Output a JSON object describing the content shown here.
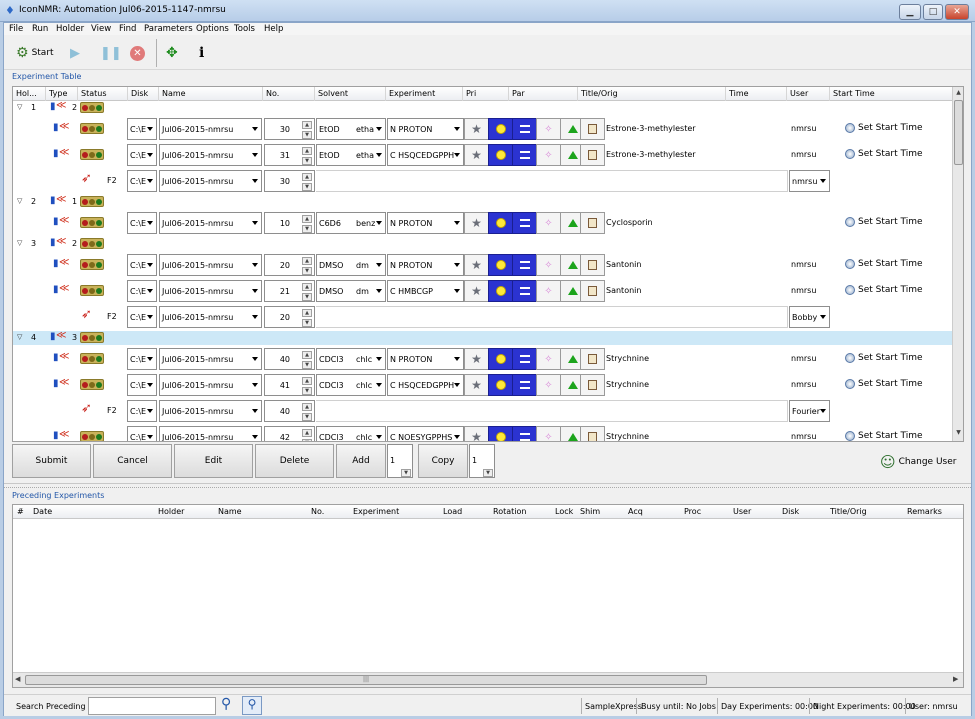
{
  "window": {
    "title": "IconNMR: Automation Jul06-2015-1147-nmrsu",
    "minimize": "▁",
    "maximize": "□",
    "close": "✕"
  },
  "menu": [
    "File",
    "Run",
    "Holder",
    "View",
    "Find",
    "Parameters",
    "Options",
    "Tools",
    "Help"
  ],
  "toolbar": {
    "start_label": "Start"
  },
  "experiment_table": {
    "title": "Experiment Table",
    "columns": [
      "Hol...",
      "Type",
      "Status",
      "Disk",
      "Name",
      "No.",
      "Solvent",
      "Experiment",
      "Pri",
      "Par",
      "Title/Orig",
      "Time",
      "User",
      "Start Time"
    ],
    "groups": [
      {
        "holder": "1",
        "count": "2",
        "rows": [
          {
            "kind": "exp",
            "disk": "C:\\E",
            "name": "Jul06-2015-nmrsu",
            "no": "30",
            "solvent": "EtOD",
            "solv2": "etha",
            "experiment": "N PROTON",
            "title": "Estrone-3-methylester",
            "user": "nmrsu",
            "start": "Set Start Time"
          },
          {
            "kind": "exp",
            "disk": "C:\\E",
            "name": "Jul06-2015-nmrsu",
            "no": "31",
            "solvent": "EtOD",
            "solv2": "etha",
            "experiment": "C HSQCEDGPPH",
            "title": "Estrone-3-methylester",
            "user": "nmrsu",
            "start": "Set Start Time"
          },
          {
            "kind": "f2",
            "label": "F2",
            "disk": "C:\\E",
            "name": "Jul06-2015-nmrsu",
            "no": "30",
            "user": "nmrsu"
          }
        ]
      },
      {
        "holder": "2",
        "count": "1",
        "rows": [
          {
            "kind": "exp",
            "disk": "C:\\E",
            "name": "Jul06-2015-nmrsu",
            "no": "10",
            "solvent": "C6D6",
            "solv2": "benz",
            "experiment": "N PROTON",
            "title": "Cyclosporin",
            "user": "",
            "start": "Set Start Time"
          }
        ]
      },
      {
        "holder": "3",
        "count": "2",
        "rows": [
          {
            "kind": "exp",
            "disk": "C:\\E",
            "name": "Jul06-2015-nmrsu",
            "no": "20",
            "solvent": "DMSO",
            "solv2": "dm",
            "experiment": "N PROTON",
            "title": "Santonin",
            "user": "nmrsu",
            "start": "Set Start Time"
          },
          {
            "kind": "exp",
            "disk": "C:\\E",
            "name": "Jul06-2015-nmrsu",
            "no": "21",
            "solvent": "DMSO",
            "solv2": "dm",
            "experiment": "C HMBCGP",
            "title": "Santonin",
            "user": "nmrsu",
            "start": "Set Start Time"
          },
          {
            "kind": "f2",
            "label": "F2",
            "disk": "C:\\E",
            "name": "Jul06-2015-nmrsu",
            "no": "20",
            "user": "Bobby"
          }
        ]
      },
      {
        "holder": "4",
        "count": "3",
        "rows": [
          {
            "kind": "exp",
            "disk": "C:\\E",
            "name": "Jul06-2015-nmrsu",
            "no": "40",
            "solvent": "CDCl3",
            "solv2": "chlc",
            "experiment": "N PROTON",
            "title": "Strychnine",
            "user": "nmrsu",
            "start": "Set Start Time"
          },
          {
            "kind": "exp",
            "disk": "C:\\E",
            "name": "Jul06-2015-nmrsu",
            "no": "41",
            "solvent": "CDCl3",
            "solv2": "chlc",
            "experiment": "C HSQCEDGPPH",
            "title": "Strychnine",
            "user": "nmrsu",
            "start": "Set Start Time"
          },
          {
            "kind": "f2",
            "label": "F2",
            "disk": "C:\\E",
            "name": "Jul06-2015-nmrsu",
            "no": "40",
            "user": "Fourier"
          },
          {
            "kind": "exp",
            "disk": "C:\\E",
            "name": "Jul06-2015-nmrsu",
            "no": "42",
            "solvent": "CDCl3",
            "solv2": "chlc",
            "experiment": "C NOESYGPPHS",
            "title": "Strychnine",
            "user": "nmrsu",
            "start": "Set Start Time"
          }
        ]
      }
    ]
  },
  "buttons": {
    "submit": "Submit",
    "cancel": "Cancel",
    "edit": "Edit",
    "delete": "Delete",
    "add": "Add",
    "add_count": "1",
    "copy": "Copy",
    "copy_count": "1",
    "change_user": "Change User"
  },
  "preceding": {
    "title": "Preceding Experiments",
    "columns": [
      "#",
      "Date",
      "Holder",
      "Name",
      "No.",
      "Experiment",
      "Load",
      "Rotation",
      "Lock",
      "Shim",
      "Acq",
      "Proc",
      "User",
      "Disk",
      "Title/Orig",
      "Remarks"
    ],
    "scroll_grip": "|||"
  },
  "status": {
    "search_label": "Search Preceding",
    "search_value": "",
    "sample_changer": "SampleXpress",
    "busy": "Busy until:  No Jobs!",
    "day": "Day Experiments:  00:00",
    "night": "Night Experiments:  00:00",
    "user": "User:  nmrsu"
  },
  "icons": {
    "start": "gear-icon",
    "play": "play-icon",
    "pause": "pause-icon",
    "stop": "stop-icon",
    "tools": "tools-icon",
    "info": "info-icon",
    "priority": "star-icon",
    "par_sun": "sun-icon",
    "par_eq": "equals-icon",
    "par_spin": "spin-icon",
    "par_tri": "triangle-icon",
    "par_doc": "document-icon"
  },
  "colors": {
    "accent": "#2357a8",
    "selected_row": "#cde8f7",
    "par_blue": "#2b33d1"
  }
}
